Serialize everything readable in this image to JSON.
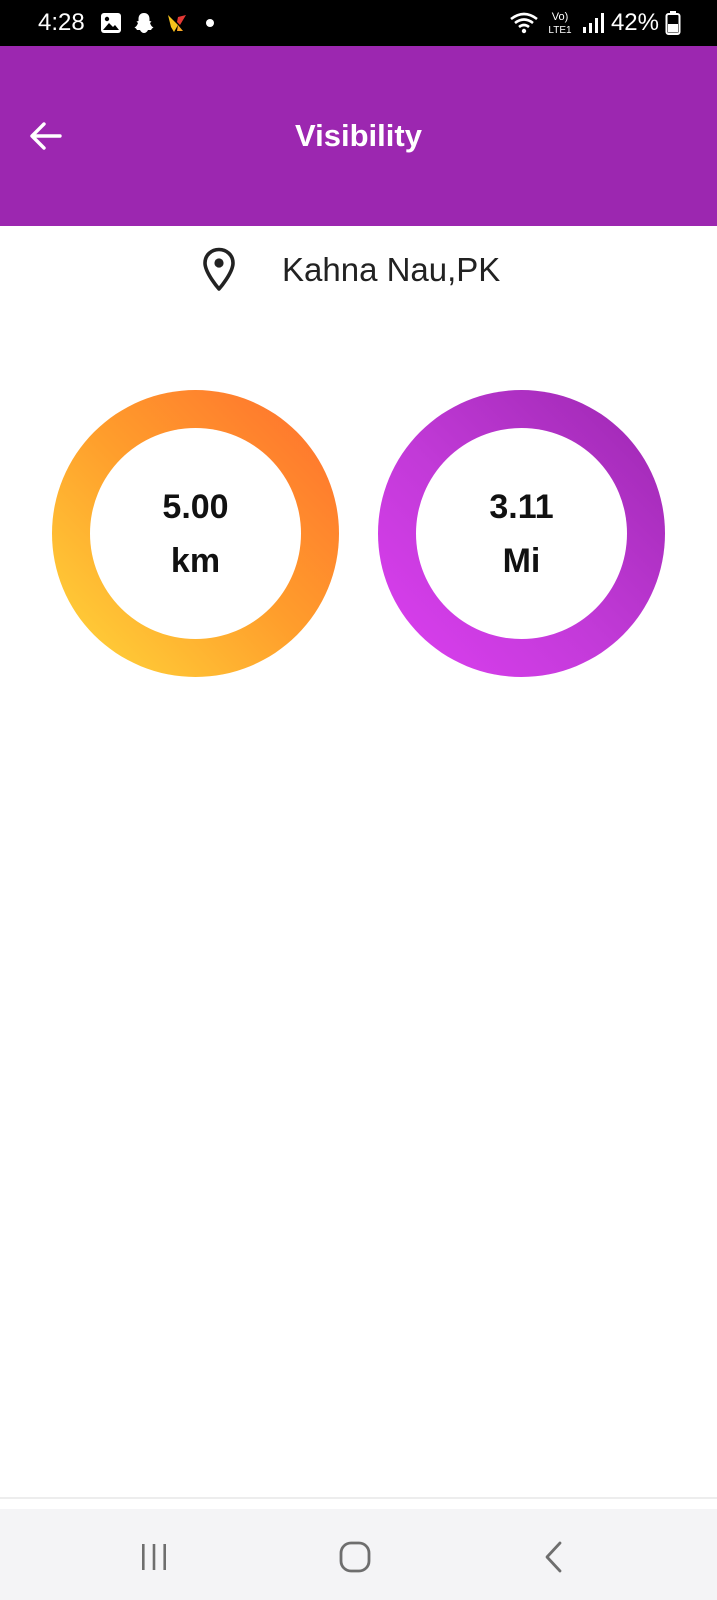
{
  "status_bar": {
    "time": "4:28",
    "battery_percent": "42%",
    "left_icons": [
      "gallery-icon",
      "snapchat-icon",
      "app-notification-icon",
      "notification-dot-icon"
    ],
    "right_icons": [
      "wifi-icon",
      "volte-icon",
      "signal-icon",
      "battery-icon"
    ],
    "volte_label": "Vo) LTE1"
  },
  "app_bar": {
    "title": "Visibility",
    "back_icon": "arrow-left-icon",
    "color": "#9c27b0"
  },
  "location": {
    "icon": "map-pin-icon",
    "name": "Kahna Nau,PK"
  },
  "visibility": {
    "km": {
      "value": "5.00",
      "unit": "km",
      "gradient": [
        "#ff6d2e",
        "#ffd93a"
      ]
    },
    "mi": {
      "value": "3.11",
      "unit": "Mi",
      "gradient": [
        "#9c27b0",
        "#dd3ff2"
      ]
    }
  },
  "nav_bar": {
    "recents_icon": "recents-icon",
    "home_icon": "home-icon",
    "back_icon": "back-chevron-icon"
  }
}
